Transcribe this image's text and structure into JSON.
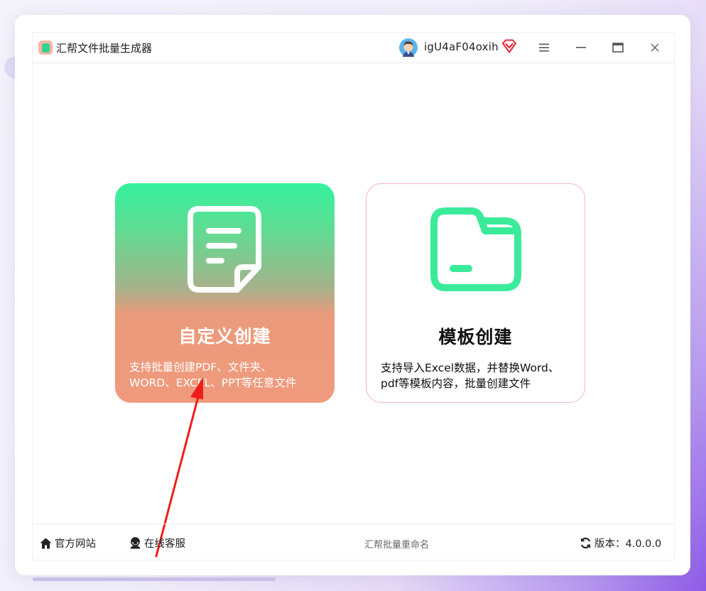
{
  "app": {
    "title": "汇帮文件批量生成器"
  },
  "user": {
    "name": "igU4aF04oxih"
  },
  "icons": {
    "app": "app-logo-icon",
    "avatar": "user-avatar",
    "vip": "vip-diamond-icon",
    "menu": "menu-icon",
    "minimize": "minimize-icon",
    "maximize": "maximize-icon",
    "close": "close-icon",
    "home": "home-icon",
    "service": "customer-service-icon",
    "refresh": "refresh-icon",
    "doc": "document-icon",
    "folder": "folder-icon"
  },
  "cards": {
    "custom": {
      "title": "自定义创建",
      "desc_line1": "支持批量创建PDF、文件夹、",
      "desc_line2": "WORD、EXCEL、PPT等任意文件"
    },
    "template": {
      "title": "模板创建",
      "desc_line1": "支持导入Excel数据，并替换Word、",
      "desc_line2": "pdf等模板内容，批量创建文件"
    }
  },
  "footer": {
    "site": "官方网站",
    "service": "在线客服",
    "center": "汇帮批量重命名",
    "version": "版本：4.0.0.0"
  },
  "colors": {
    "accent_green": "#35f19e",
    "accent_salmon": "#ef9a7d",
    "template_border": "#f0b6c8",
    "folder_green": "#3ceb9a",
    "arrow_red": "#f01d1d",
    "vip_red": "#e8243a"
  }
}
